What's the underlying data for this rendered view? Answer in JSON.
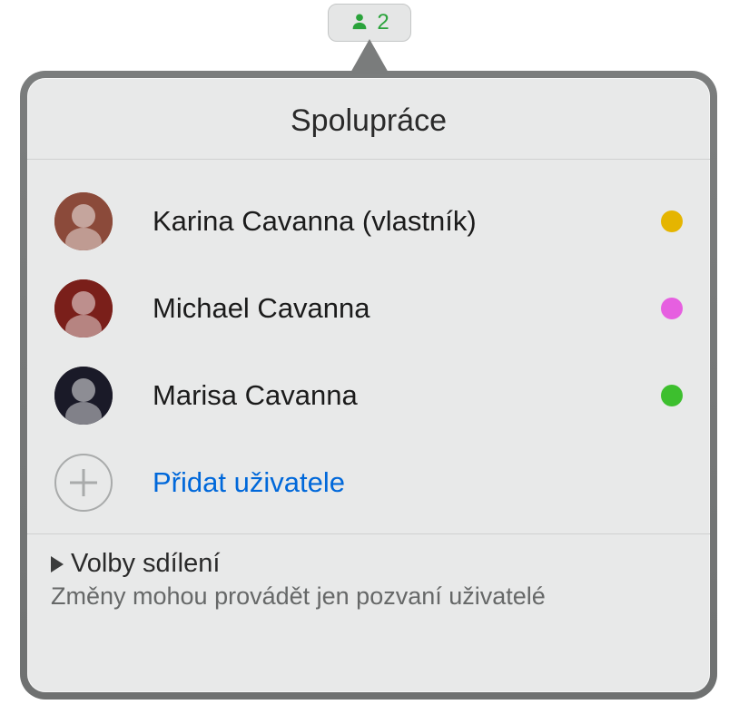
{
  "toolbar": {
    "collaborator_count": "2"
  },
  "panel": {
    "title": "Spolupráce"
  },
  "participants": [
    {
      "name": "Karina Cavanna (vlastník)",
      "dot_color": "#e5b500",
      "avatar_bg": "#8b4a3a",
      "avatar_bg2": "#d89070"
    },
    {
      "name": "Michael Cavanna",
      "dot_color": "#e65fe0",
      "avatar_bg": "#7a1f1a",
      "avatar_bg2": "#6b4a2b"
    },
    {
      "name": "Marisa Cavanna",
      "dot_color": "#3dbf2e",
      "avatar_bg": "#1a1a28",
      "avatar_bg2": "#d8a888"
    }
  ],
  "add": {
    "label": "Přidat uživatele"
  },
  "options": {
    "title": "Volby sdílení",
    "subtitle": "Změny mohou provádět jen pozvaní uživatelé"
  }
}
